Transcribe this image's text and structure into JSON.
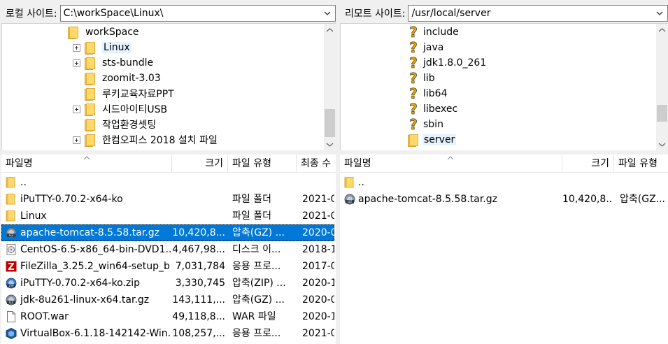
{
  "local": {
    "site_label": "로컬 사이트:",
    "site_path": "C:\\workSpace\\Linux\\",
    "tree": [
      {
        "label": "workSpace",
        "expander": false,
        "hl": false
      },
      {
        "label": "Linux",
        "expander": true,
        "hl": true
      },
      {
        "label": "sts-bundle",
        "expander": true,
        "hl": false
      },
      {
        "label": "zoomit-3.03",
        "expander": false,
        "hl": false
      },
      {
        "label": "루키교육자료PPT",
        "expander": false,
        "hl": false
      },
      {
        "label": "시드아이티USB",
        "expander": true,
        "hl": false
      },
      {
        "label": "작업환경셋팅",
        "expander": false,
        "hl": false
      },
      {
        "label": "한컴오피스 2018 설치 파일",
        "expander": true,
        "hl": false
      }
    ],
    "columns": {
      "name": "파일명",
      "size": "크기",
      "type": "파일 유형",
      "modified": "최종 수"
    },
    "files": [
      {
        "icon": "folder-icon",
        "name": "..",
        "size": "",
        "type": "",
        "modified": "",
        "selected": false
      },
      {
        "icon": "folder-icon",
        "name": "iPuTTY-0.70.2-x64-ko",
        "size": "",
        "type": "파일 폴더",
        "modified": "2021-0",
        "selected": false
      },
      {
        "icon": "folder-icon",
        "name": "Linux",
        "size": "",
        "type": "파일 폴더",
        "modified": "2021-0",
        "selected": false
      },
      {
        "icon": "gz-archive-icon",
        "name": "apache-tomcat-8.5.58.tar.gz",
        "size": "10,420,8...",
        "type": "압축(GZ) ...",
        "modified": "2020-0",
        "selected": true
      },
      {
        "icon": "disc-image-icon",
        "name": "CentOS-6.5-x86_64-bin-DVD1...",
        "size": "4,467,98...",
        "type": "디스크 이...",
        "modified": "2018-1",
        "selected": false
      },
      {
        "icon": "filezilla-icon",
        "name": "FileZilla_3.25.2_win64-setup_b...",
        "size": "7,031,784",
        "type": "응용 프로...",
        "modified": "2017-0",
        "selected": false
      },
      {
        "icon": "zip-archive-icon",
        "name": "iPuTTY-0.70.2-x64-ko.zip",
        "size": "3,330,745",
        "type": "압축(ZIP) ...",
        "modified": "2020-1",
        "selected": false
      },
      {
        "icon": "gz-archive-icon",
        "name": "jdk-8u261-linux-x64.tar.gz",
        "size": "143,111,...",
        "type": "압축(GZ) ...",
        "modified": "2020-0",
        "selected": false
      },
      {
        "icon": "file-icon",
        "name": "ROOT.war",
        "size": "49,118,8...",
        "type": "WAR 파일",
        "modified": "2020-1",
        "selected": false
      },
      {
        "icon": "virtualbox-icon",
        "name": "VirtualBox-6.1.18-142142-Win...",
        "size": "108,257,...",
        "type": "응용 프로...",
        "modified": "2021-0",
        "selected": false
      }
    ]
  },
  "remote": {
    "site_label": "리모트 사이트:",
    "site_path": "/usr/local/server",
    "tree": [
      {
        "label": "include",
        "icon": "unknown"
      },
      {
        "label": "java",
        "icon": "unknown"
      },
      {
        "label": "jdk1.8.0_261",
        "icon": "unknown"
      },
      {
        "label": "lib",
        "icon": "unknown"
      },
      {
        "label": "lib64",
        "icon": "unknown"
      },
      {
        "label": "libexec",
        "icon": "unknown"
      },
      {
        "label": "sbin",
        "icon": "unknown"
      },
      {
        "label": "server",
        "icon": "folder"
      }
    ],
    "columns": {
      "name": "파일명",
      "size": "크기",
      "type": "파일 유형"
    },
    "files": [
      {
        "icon": "folder-icon",
        "name": "..",
        "size": "",
        "type": ""
      },
      {
        "icon": "gz-archive-icon",
        "name": "apache-tomcat-8.5.58.tar.gz",
        "size": "10,420,8...",
        "type": "압축(GZ..."
      }
    ]
  },
  "colors": {
    "selection": "#0078d7",
    "folder": "#ffd96b",
    "tree_highlight": "#e5f3ff"
  }
}
